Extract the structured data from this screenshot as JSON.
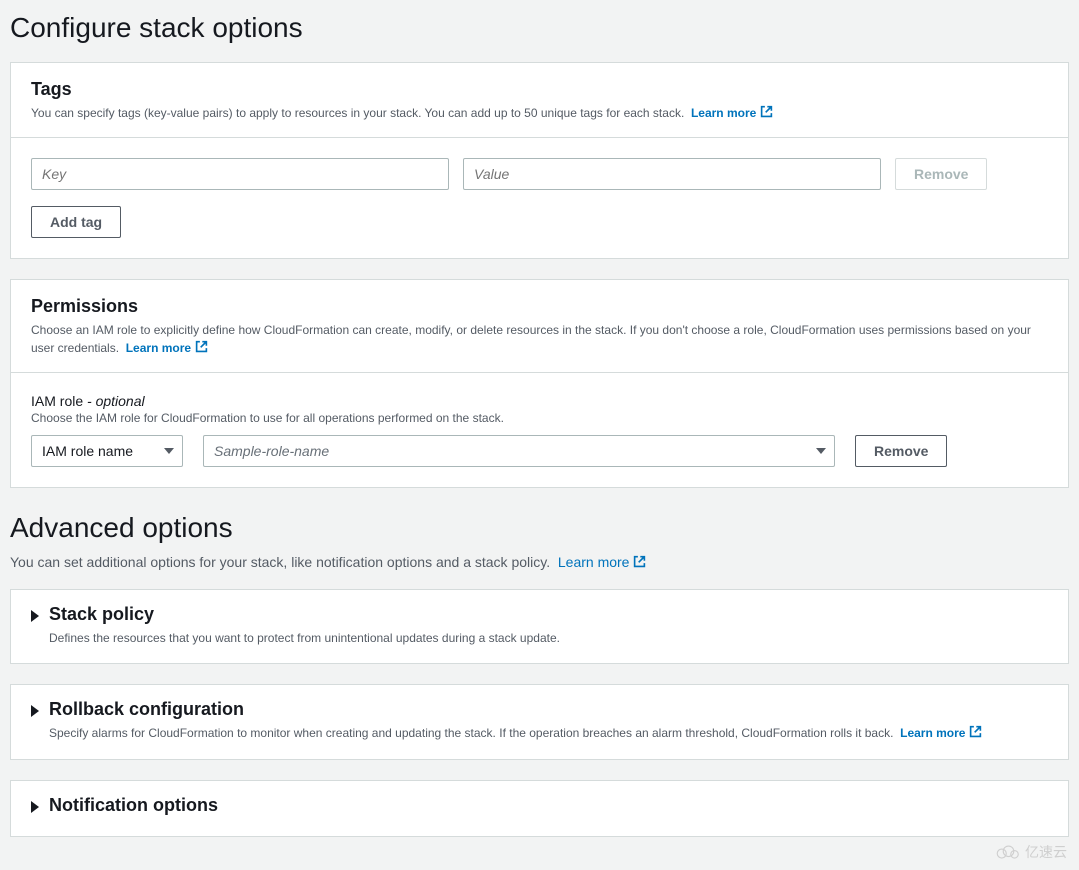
{
  "page": {
    "title": "Configure stack options",
    "advanced_title": "Advanced options",
    "advanced_desc": "You can set additional options for your stack, like notification options and a stack policy.",
    "learn_more": "Learn more"
  },
  "tags": {
    "title": "Tags",
    "description": "You can specify tags (key-value pairs) to apply to resources in your stack. You can add up to 50 unique tags for each stack.",
    "learn_more": "Learn more",
    "key_placeholder": "Key",
    "value_placeholder": "Value",
    "remove_label": "Remove",
    "add_tag_label": "Add tag"
  },
  "permissions": {
    "title": "Permissions",
    "description": "Choose an IAM role to explicitly define how CloudFormation can create, modify, or delete resources in the stack. If you don't choose a role, CloudFormation uses permissions based on your user credentials.",
    "learn_more": "Learn more",
    "iam_label_prefix": "IAM role",
    "iam_label_suffix": " - optional",
    "iam_desc": "Choose the IAM role for CloudFormation to use for all operations performed on the stack.",
    "role_type_selected": "IAM role name",
    "role_placeholder": "Sample-role-name",
    "remove_label": "Remove"
  },
  "expand": {
    "stack_policy": {
      "title": "Stack policy",
      "desc": "Defines the resources that you want to protect from unintentional updates during a stack update."
    },
    "rollback": {
      "title": "Rollback configuration",
      "desc": "Specify alarms for CloudFormation to monitor when creating and updating the stack. If the operation breaches an alarm threshold, CloudFormation rolls it back.",
      "learn_more": "Learn more"
    },
    "notification": {
      "title": "Notification options"
    }
  },
  "watermark": "亿速云"
}
